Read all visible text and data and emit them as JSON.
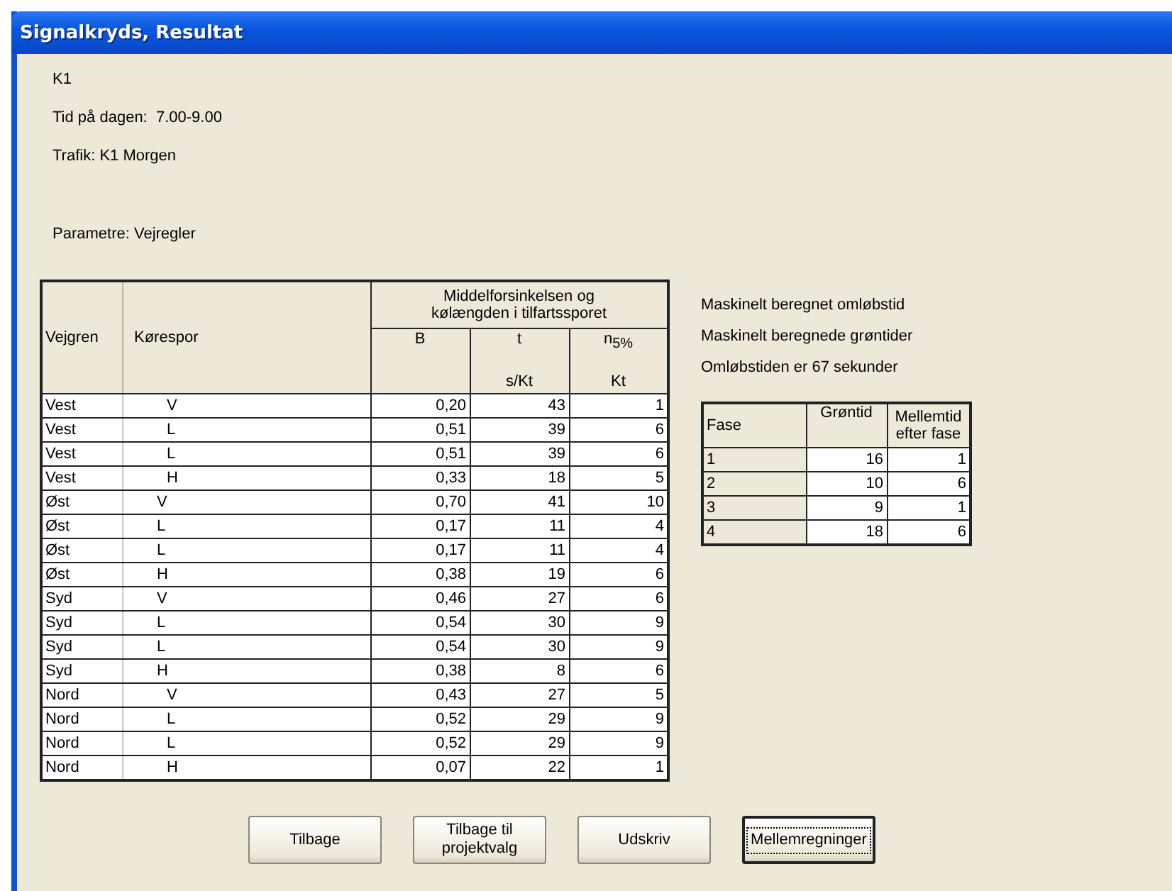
{
  "window": {
    "title": "Signalkryds, Resultat"
  },
  "info_lines": [
    "K1",
    "Tid på dagen:  7.00-9.00",
    "Trafik: K1 Morgen"
  ],
  "parameters": "Parametre: Vejregler",
  "delay_table": {
    "group_heading": "Middelforsinkelsen og kølængden i tilfartssporet",
    "columns": [
      {
        "label": "Vejgren"
      },
      {
        "label": "Kørespor"
      },
      {
        "label": "B"
      },
      {
        "label": "t",
        "unit": "s/Kt"
      },
      {
        "label": "n$_{5%}$",
        "unit": "Kt"
      }
    ],
    "rows": [
      [
        "Vest",
        "V",
        "0,20",
        "43",
        "1"
      ],
      [
        "Vest",
        "L",
        "0,51",
        "39",
        "6"
      ],
      [
        "Vest",
        "L",
        "0,51",
        "39",
        "6"
      ],
      [
        "Vest",
        "H",
        "0,33",
        "18",
        "5"
      ],
      [
        "Øst",
        "V",
        "0,70",
        "41",
        "10"
      ],
      [
        "Øst",
        "L",
        "0,17",
        "11",
        "4"
      ],
      [
        "Øst",
        "L",
        "0,17",
        "11",
        "4"
      ],
      [
        "Øst",
        "H",
        "0,38",
        "19",
        "6"
      ],
      [
        "Syd",
        "V",
        "0,46",
        "27",
        "6"
      ],
      [
        "Syd",
        "L",
        "0,54",
        "30",
        "9"
      ],
      [
        "Syd",
        "L",
        "0,54",
        "30",
        "9"
      ],
      [
        "Syd",
        "H",
        "0,38",
        "8",
        "6"
      ],
      [
        "Nord",
        "V",
        "0,43",
        "27",
        "5"
      ],
      [
        "Nord",
        "L",
        "0,52",
        "29",
        "9"
      ],
      [
        "Nord",
        "L",
        "0,52",
        "29",
        "9"
      ],
      [
        "Nord",
        "H",
        "0,07",
        "22",
        "1"
      ]
    ]
  },
  "notes": [
    "Maskinelt beregnet omløbstid",
    "Maskinelt beregnede grøntider",
    "Omløbstiden er 67 sekunder"
  ],
  "phase_table": {
    "columns": [
      "Fase",
      "Grøntid",
      "Mellemtid efter fase"
    ],
    "rows": [
      [
        "1",
        "16",
        "1"
      ],
      [
        "2",
        "10",
        "6"
      ],
      [
        "3",
        "9",
        "1"
      ],
      [
        "4",
        "18",
        "6"
      ]
    ]
  },
  "buttons": [
    {
      "label": "Tilbage",
      "focused": false
    },
    {
      "label": "Tilbage til projektvalg",
      "focused": false
    },
    {
      "label": "Udskriv",
      "focused": false
    },
    {
      "label": "Mellemregninger",
      "focused": true
    }
  ]
}
